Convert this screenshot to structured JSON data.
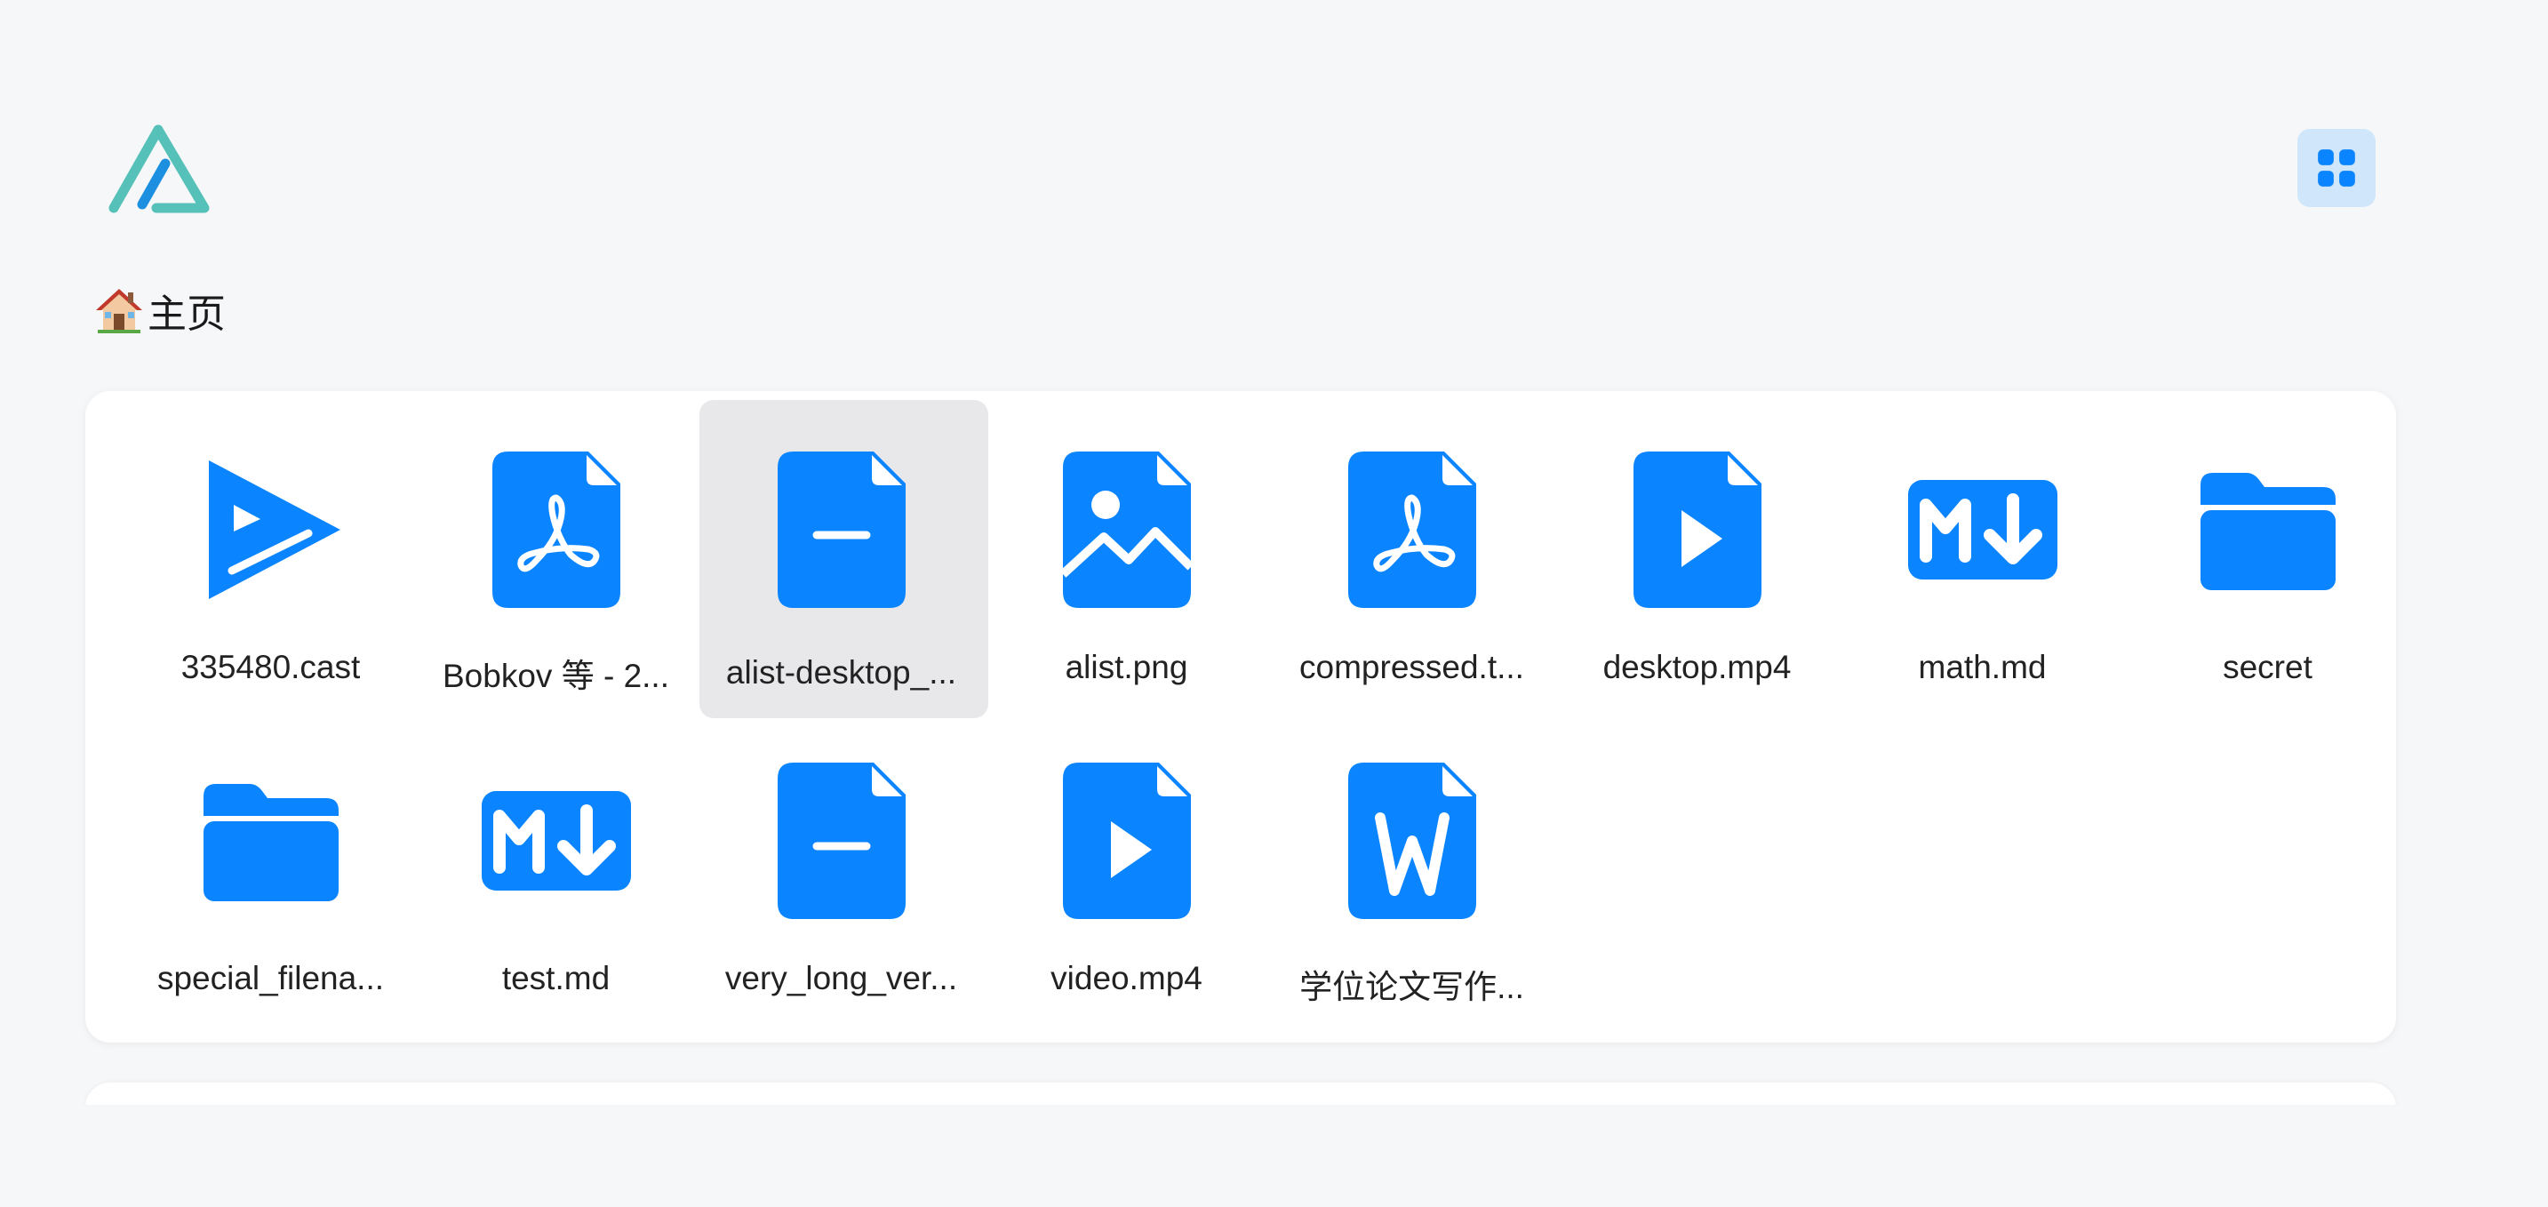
{
  "app": {
    "logo": "alist-logo"
  },
  "header": {
    "layout_toggle_icon": "grid-view-icon"
  },
  "breadcrumb": {
    "icon": "house-icon",
    "label": "主页"
  },
  "colors": {
    "accent": "#0a84ff",
    "logo_teal": "#55c1b8",
    "logo_blue": "#1d8fe0",
    "selected_bg": "#e8e8ea",
    "toggle_bg": "#cfe6fb"
  },
  "files": [
    {
      "name": "335480.cast",
      "icon": "asciinema-icon"
    },
    {
      "name": "Bobkov 等 - 2...",
      "icon": "pdf-file-icon"
    },
    {
      "name": "alist-desktop_...",
      "icon": "generic-file-icon",
      "selected": true
    },
    {
      "name": "alist.png",
      "icon": "image-file-icon"
    },
    {
      "name": "compressed.t...",
      "icon": "pdf-file-icon"
    },
    {
      "name": "desktop.mp4",
      "icon": "video-file-icon"
    },
    {
      "name": "math.md",
      "icon": "markdown-icon"
    },
    {
      "name": "secret",
      "icon": "folder-icon"
    },
    {
      "name": "special_filena...",
      "icon": "folder-icon"
    },
    {
      "name": "test.md",
      "icon": "markdown-icon"
    },
    {
      "name": "very_long_ver...",
      "icon": "generic-file-icon"
    },
    {
      "name": "video.mp4",
      "icon": "video-file-icon"
    },
    {
      "name": "学位论文写作...",
      "icon": "word-file-icon"
    }
  ]
}
